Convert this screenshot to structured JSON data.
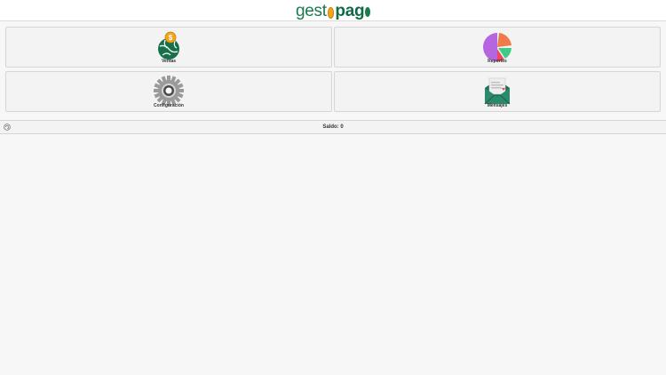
{
  "header": {
    "logo": {
      "part1": "gest",
      "part2": "pag",
      "colors": {
        "green": "#1b7a4e",
        "coin": "#f2a51c"
      }
    }
  },
  "tiles": [
    {
      "id": "ventas",
      "label": "Ventas",
      "icon": "globe-coin-icon"
    },
    {
      "id": "reportes",
      "label": "Reportes",
      "icon": "pie-chart-icon"
    },
    {
      "id": "configuracion",
      "label": "Configuración",
      "icon": "gear-icon"
    },
    {
      "id": "mensajes",
      "label": "Mensajes",
      "icon": "envelope-icon"
    }
  ],
  "footer": {
    "saldo_label": "Saldo:",
    "saldo_value": "0",
    "saldo_text": "Saldo: 0",
    "refresh_icon": "refresh-icon"
  }
}
